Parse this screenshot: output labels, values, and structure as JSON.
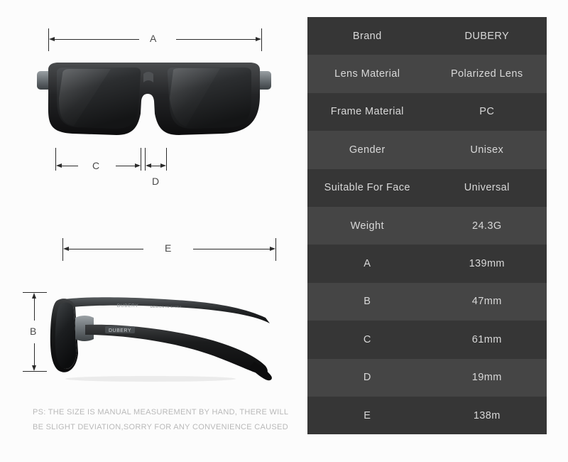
{
  "product": {
    "brand": "DUBERY",
    "temple_brand_text": "DUBERY"
  },
  "diagram": {
    "front_view_name": "sunglasses-front-view",
    "side_view_name": "sunglasses-side-view",
    "labels": {
      "a": "A",
      "b": "B",
      "c": "C",
      "d": "D",
      "e": "E"
    }
  },
  "disclaimer": {
    "line1": "PS: THE SIZE IS MANUAL MEASUREMENT BY HAND, THERE WILL",
    "line2": "BE SLIGHT DEVIATION,SORRY FOR ANY CONVENIENCE CAUSED"
  },
  "spec_table": {
    "rows": [
      {
        "label": "Brand",
        "value": "DUBERY"
      },
      {
        "label": "Lens Material",
        "value": "Polarized Lens"
      },
      {
        "label": "Frame Material",
        "value": "PC"
      },
      {
        "label": "Gender",
        "value": "Unisex"
      },
      {
        "label": "Suitable For Face",
        "value": "Universal"
      },
      {
        "label": "Weight",
        "value": "24.3G"
      },
      {
        "label": "A",
        "value": "139mm"
      },
      {
        "label": "B",
        "value": "47mm"
      },
      {
        "label": "C",
        "value": "61mm"
      },
      {
        "label": "D",
        "value": "19mm"
      },
      {
        "label": "E",
        "value": "138m"
      }
    ]
  },
  "colors": {
    "page_background": "#fcfcfc",
    "row_dark": "#363636",
    "row_light": "#454545",
    "table_text": "#d8d8d8",
    "dimension_line": "#2b2b2b",
    "dimension_label": "#4a4a4a",
    "disclaimer_text": "#b9b9b9"
  }
}
